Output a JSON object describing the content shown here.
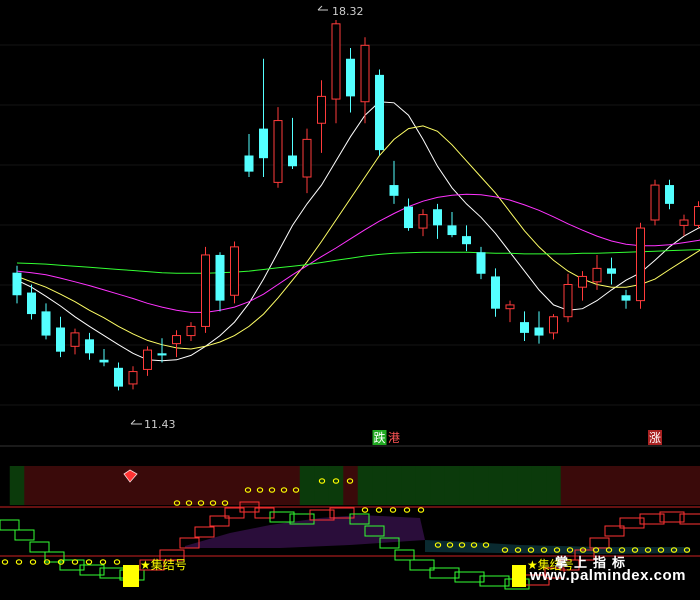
{
  "chart_data": [
    {
      "type": "candlestick",
      "price_range": [
        10.6,
        18.6
      ],
      "max_label": "18.32",
      "min_label": "11.43",
      "candles": [
        {
          "o": 13.62,
          "h": 13.75,
          "l": 13.05,
          "c": 13.2,
          "bear": true
        },
        {
          "o": 13.25,
          "h": 13.4,
          "l": 12.75,
          "c": 12.85,
          "bear": true
        },
        {
          "o": 12.9,
          "h": 13.05,
          "l": 12.38,
          "c": 12.45,
          "bear": true
        },
        {
          "o": 12.6,
          "h": 12.8,
          "l": 12.05,
          "c": 12.15,
          "bear": true
        },
        {
          "o": 12.25,
          "h": 12.58,
          "l": 12.1,
          "c": 12.5,
          "bear": false
        },
        {
          "o": 12.38,
          "h": 12.5,
          "l": 12.0,
          "c": 12.12,
          "bear": true
        },
        {
          "o": 12.0,
          "h": 12.2,
          "l": 11.88,
          "c": 11.95,
          "bear": true
        },
        {
          "o": 11.85,
          "h": 11.95,
          "l": 11.43,
          "c": 11.5,
          "bear": true
        },
        {
          "o": 11.55,
          "h": 11.88,
          "l": 11.45,
          "c": 11.78,
          "bear": false
        },
        {
          "o": 11.82,
          "h": 12.25,
          "l": 11.7,
          "c": 12.18,
          "bear": false
        },
        {
          "o": 12.12,
          "h": 12.4,
          "l": 11.95,
          "c": 12.08,
          "bear": true
        },
        {
          "o": 12.3,
          "h": 12.55,
          "l": 12.05,
          "c": 12.45,
          "bear": false
        },
        {
          "o": 12.45,
          "h": 12.7,
          "l": 12.35,
          "c": 12.62,
          "bear": false
        },
        {
          "o": 12.62,
          "h": 14.1,
          "l": 12.5,
          "c": 13.95,
          "bear": false
        },
        {
          "o": 13.95,
          "h": 14.0,
          "l": 12.9,
          "c": 13.1,
          "bear": true
        },
        {
          "o": 13.2,
          "h": 14.2,
          "l": 13.05,
          "c": 14.1,
          "bear": false
        },
        {
          "o": 15.8,
          "h": 16.2,
          "l": 15.4,
          "c": 15.5,
          "bear": true
        },
        {
          "o": 16.3,
          "h": 17.6,
          "l": 15.4,
          "c": 15.75,
          "bear": true
        },
        {
          "o": 15.3,
          "h": 16.7,
          "l": 15.2,
          "c": 16.45,
          "bear": false
        },
        {
          "o": 15.8,
          "h": 16.5,
          "l": 15.55,
          "c": 15.6,
          "bear": true
        },
        {
          "o": 15.4,
          "h": 16.3,
          "l": 15.1,
          "c": 16.1,
          "bear": false
        },
        {
          "o": 16.4,
          "h": 17.2,
          "l": 15.85,
          "c": 16.9,
          "bear": false
        },
        {
          "o": 16.85,
          "h": 18.32,
          "l": 16.4,
          "c": 18.25,
          "bear": false
        },
        {
          "o": 17.6,
          "h": 17.8,
          "l": 16.6,
          "c": 16.9,
          "bear": true
        },
        {
          "o": 16.8,
          "h": 18.0,
          "l": 16.4,
          "c": 17.85,
          "bear": false
        },
        {
          "o": 17.3,
          "h": 17.4,
          "l": 15.8,
          "c": 15.9,
          "bear": true
        },
        {
          "o": 15.25,
          "h": 15.7,
          "l": 14.9,
          "c": 15.05,
          "bear": true
        },
        {
          "o": 14.85,
          "h": 15.0,
          "l": 14.4,
          "c": 14.45,
          "bear": true
        },
        {
          "o": 14.45,
          "h": 14.8,
          "l": 14.3,
          "c": 14.7,
          "bear": false
        },
        {
          "o": 14.8,
          "h": 14.9,
          "l": 14.25,
          "c": 14.5,
          "bear": true
        },
        {
          "o": 14.5,
          "h": 14.75,
          "l": 14.28,
          "c": 14.32,
          "bear": true
        },
        {
          "o": 14.3,
          "h": 14.5,
          "l": 14.02,
          "c": 14.15,
          "bear": true
        },
        {
          "o": 14.0,
          "h": 14.1,
          "l": 13.5,
          "c": 13.6,
          "bear": true
        },
        {
          "o": 13.55,
          "h": 13.7,
          "l": 12.8,
          "c": 12.95,
          "bear": true
        },
        {
          "o": 12.95,
          "h": 13.1,
          "l": 12.7,
          "c": 13.02,
          "bear": false
        },
        {
          "o": 12.7,
          "h": 12.9,
          "l": 12.35,
          "c": 12.5,
          "bear": true
        },
        {
          "o": 12.6,
          "h": 12.9,
          "l": 12.3,
          "c": 12.45,
          "bear": true
        },
        {
          "o": 12.5,
          "h": 12.85,
          "l": 12.38,
          "c": 12.8,
          "bear": false
        },
        {
          "o": 12.8,
          "h": 13.6,
          "l": 12.7,
          "c": 13.4,
          "bear": false
        },
        {
          "o": 13.35,
          "h": 13.65,
          "l": 13.1,
          "c": 13.55,
          "bear": false
        },
        {
          "o": 13.45,
          "h": 13.95,
          "l": 13.3,
          "c": 13.7,
          "bear": false
        },
        {
          "o": 13.7,
          "h": 13.9,
          "l": 13.4,
          "c": 13.6,
          "bear": true
        },
        {
          "o": 13.2,
          "h": 13.3,
          "l": 12.95,
          "c": 13.1,
          "bear": true
        },
        {
          "o": 13.1,
          "h": 14.55,
          "l": 12.95,
          "c": 14.45,
          "bear": false
        },
        {
          "o": 14.6,
          "h": 15.35,
          "l": 14.5,
          "c": 15.25,
          "bear": false
        },
        {
          "o": 15.25,
          "h": 15.35,
          "l": 14.8,
          "c": 14.9,
          "bear": true
        },
        {
          "o": 14.5,
          "h": 14.7,
          "l": 14.3,
          "c": 14.6,
          "bear": false
        },
        {
          "o": 14.5,
          "h": 14.95,
          "l": 14.45,
          "c": 14.85,
          "bear": false
        },
        {
          "o": 15.1,
          "h": 15.2,
          "l": 14.55,
          "c": 14.7,
          "bear": true
        },
        {
          "o": 14.8,
          "h": 14.95,
          "l": 14.2,
          "c": 14.6,
          "bear": false
        }
      ],
      "ma": [
        {
          "color": "#ffffff",
          "values": [
            13.48,
            13.35,
            13.18,
            13.0,
            12.8,
            12.62,
            12.45,
            12.28,
            12.12,
            12.0,
            11.98,
            12.0,
            12.08,
            12.25,
            12.45,
            12.7,
            13.05,
            13.5,
            14.0,
            14.5,
            14.9,
            15.25,
            15.7,
            16.15,
            16.55,
            16.8,
            16.78,
            16.55,
            16.1,
            15.6,
            15.2,
            14.9,
            14.65,
            14.35,
            14.0,
            13.65,
            13.3,
            13.02,
            12.92,
            12.95,
            13.1,
            13.3,
            13.48,
            13.62,
            13.85,
            14.1,
            14.3,
            14.45,
            14.55,
            14.62
          ]
        },
        {
          "color": "#ffff66",
          "values": [
            13.55,
            13.45,
            13.35,
            13.22,
            13.08,
            12.92,
            12.78,
            12.62,
            12.48,
            12.36,
            12.28,
            12.22,
            12.2,
            12.25,
            12.33,
            12.45,
            12.62,
            12.85,
            13.15,
            13.48,
            13.82,
            14.2,
            14.6,
            15.0,
            15.4,
            15.8,
            16.1,
            16.3,
            16.35,
            16.25,
            16.0,
            15.7,
            15.4,
            15.1,
            14.75,
            14.4,
            14.1,
            13.85,
            13.65,
            13.5,
            13.4,
            13.35,
            13.35,
            13.4,
            13.5,
            13.68,
            13.85,
            14.02,
            14.18,
            14.3
          ]
        },
        {
          "color": "#ff33ff",
          "values": [
            13.65,
            13.62,
            13.58,
            13.52,
            13.45,
            13.38,
            13.3,
            13.22,
            13.14,
            13.05,
            12.98,
            12.92,
            12.88,
            12.88,
            12.92,
            12.98,
            13.08,
            13.22,
            13.4,
            13.58,
            13.75,
            13.92,
            14.08,
            14.25,
            14.42,
            14.58,
            14.72,
            14.85,
            14.95,
            15.02,
            15.06,
            15.08,
            15.07,
            15.03,
            14.97,
            14.88,
            14.78,
            14.66,
            14.53,
            14.41,
            14.3,
            14.21,
            14.15,
            14.12,
            14.12,
            14.14,
            14.18,
            14.22,
            14.28,
            14.35
          ]
        },
        {
          "color": "#33ff33",
          "values": [
            13.8,
            13.79,
            13.78,
            13.76,
            13.74,
            13.72,
            13.7,
            13.68,
            13.66,
            13.64,
            13.62,
            13.61,
            13.61,
            13.61,
            13.62,
            13.63,
            13.65,
            13.68,
            13.71,
            13.74,
            13.77,
            13.81,
            13.85,
            13.89,
            13.93,
            13.96,
            13.98,
            13.99,
            14.0,
            14.0,
            14.0,
            14.0,
            13.99,
            13.98,
            13.98,
            13.97,
            13.97,
            13.97,
            13.97,
            13.98,
            13.98,
            13.99,
            14.0,
            14.01,
            14.02,
            14.03,
            14.04,
            14.05,
            14.06,
            14.07
          ]
        }
      ],
      "markers": [
        {
          "text": "跌",
          "bg": "#22aa22",
          "fg": "#ffffff",
          "index": 25
        },
        {
          "text": "港",
          "bg": "#000000",
          "fg": "#ff5555",
          "index": 26
        },
        {
          "text": "涨",
          "bg": "#aa2222",
          "fg": "#ffffff",
          "index": 44
        }
      ]
    },
    {
      "type": "indicator",
      "label": "★集结号",
      "label2": "★集结号",
      "zone_colors": [
        "#0b3a0b",
        "#3a0a0a",
        "#0b3a0b",
        "#3a0a0a",
        "#0b3a0b",
        "#3a0a0a",
        "#0b3a0b"
      ],
      "zones": [
        0,
        1,
        1,
        1,
        1,
        1,
        1,
        1,
        1,
        1,
        1,
        1,
        1,
        1,
        1,
        1,
        1,
        1,
        1,
        1,
        2,
        2,
        2,
        3,
        2,
        2,
        2,
        2,
        2,
        2,
        2,
        2,
        2,
        2,
        2,
        2,
        2,
        2,
        3,
        3,
        3,
        3,
        3,
        3,
        3,
        3,
        3,
        3,
        3,
        2
      ]
    }
  ],
  "brand_text": "掌上指标",
  "watermark": "www.palmindex.com"
}
